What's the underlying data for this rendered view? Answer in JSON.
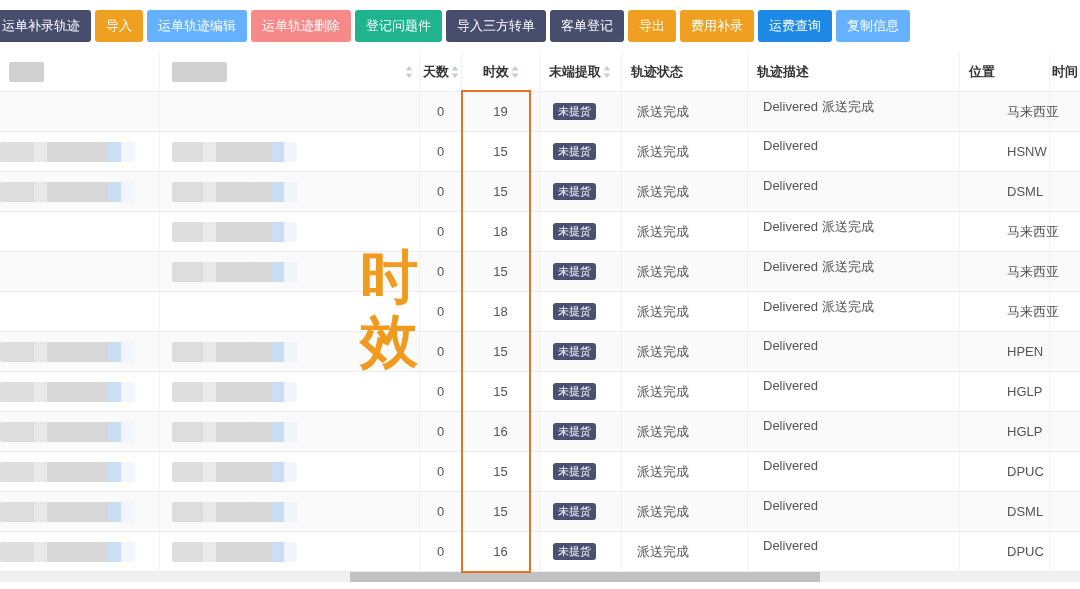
{
  "toolbar": {
    "buttons": [
      {
        "label": "运单补录轨迹",
        "kind": "dark"
      },
      {
        "label": "导入",
        "kind": "warning"
      },
      {
        "label": "运单轨迹编辑",
        "kind": "light"
      },
      {
        "label": "运单轨迹删除",
        "kind": "danger"
      },
      {
        "label": "登记问题件",
        "kind": "success"
      },
      {
        "label": "导入三方转单",
        "kind": "dark"
      },
      {
        "label": "客单登记",
        "kind": "dark"
      },
      {
        "label": "导出",
        "kind": "warning"
      },
      {
        "label": "费用补录",
        "kind": "warning"
      },
      {
        "label": "运费查询",
        "kind": "primary"
      },
      {
        "label": "复制信息",
        "kind": "light"
      }
    ]
  },
  "table": {
    "columns": [
      {
        "kind": "number",
        "label": "天数",
        "sortable": true
      },
      {
        "kind": "number",
        "label": "时效",
        "sortable": true
      },
      {
        "kind": "tag",
        "label": "末端提取",
        "sortable": true
      },
      {
        "kind": "text",
        "label": "轨迹状态",
        "sortable": false
      },
      {
        "kind": "desc",
        "label": "轨迹描述",
        "sortable": false
      },
      {
        "kind": "loc",
        "label": "位置",
        "sortable": false
      },
      {
        "kind": "text",
        "label": "时间",
        "sortable": false
      }
    ],
    "header_masked": [
      true,
      true
    ],
    "masked_sortable": [
      false,
      true
    ],
    "rows": [
      {
        "masked": [
          false,
          false
        ],
        "cells": [
          "0",
          "19",
          "未提货",
          "派送完成",
          "Delivered 派送完成",
          "马来西亚"
        ]
      },
      {
        "masked": [
          true,
          true
        ],
        "cells": [
          "0",
          "15",
          "未提货",
          "派送完成",
          "Delivered",
          "HSNW"
        ]
      },
      {
        "masked": [
          true,
          true
        ],
        "cells": [
          "0",
          "15",
          "未提货",
          "派送完成",
          "Delivered",
          "DSML"
        ]
      },
      {
        "masked": [
          false,
          true
        ],
        "cells": [
          "0",
          "18",
          "未提货",
          "派送完成",
          "Delivered 派送完成",
          "马来西亚"
        ]
      },
      {
        "masked": [
          false,
          true
        ],
        "cells": [
          "0",
          "15",
          "未提货",
          "派送完成",
          "Delivered 派送完成",
          "马来西亚"
        ]
      },
      {
        "masked": [
          false,
          false
        ],
        "cells": [
          "0",
          "18",
          "未提货",
          "派送完成",
          "Delivered 派送完成",
          "马来西亚"
        ]
      },
      {
        "masked": [
          true,
          true
        ],
        "cells": [
          "0",
          "15",
          "未提货",
          "派送完成",
          "Delivered",
          "HPEN"
        ]
      },
      {
        "masked": [
          true,
          true
        ],
        "cells": [
          "0",
          "15",
          "未提货",
          "派送完成",
          "Delivered",
          "HGLP"
        ]
      },
      {
        "masked": [
          true,
          true
        ],
        "cells": [
          "0",
          "16",
          "未提货",
          "派送完成",
          "Delivered",
          "HGLP"
        ]
      },
      {
        "masked": [
          true,
          true
        ],
        "cells": [
          "0",
          "15",
          "未提货",
          "派送完成",
          "Delivered",
          "DPUC"
        ]
      },
      {
        "masked": [
          true,
          true
        ],
        "cells": [
          "0",
          "15",
          "未提货",
          "派送完成",
          "Delivered",
          "DSML"
        ]
      },
      {
        "masked": [
          true,
          true
        ],
        "cells": [
          "0",
          "16",
          "未提货",
          "派送完成",
          "Delivered",
          "DPUC"
        ]
      }
    ]
  },
  "annotation": {
    "label": "时效"
  }
}
